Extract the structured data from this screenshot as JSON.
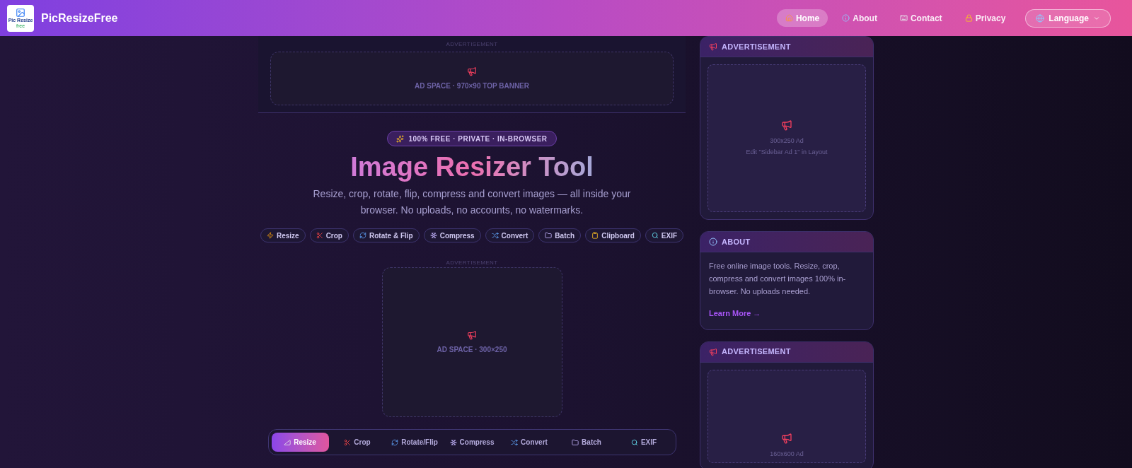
{
  "header": {
    "logo": {
      "line1": "Pic Resize",
      "line2": "free"
    },
    "brand": "PicResizeFree",
    "nav": [
      {
        "label": "Home",
        "selected": true
      },
      {
        "label": "About",
        "selected": false
      },
      {
        "label": "Contact",
        "selected": false
      },
      {
        "label": "Privacy",
        "selected": false
      }
    ],
    "language": "Language"
  },
  "top_ad": {
    "caption": "ADVERTISEMENT",
    "text": "AD SPACE · 970×90 TOP BANNER"
  },
  "hero": {
    "badge": "100% FREE · PRIVATE · IN-BROWSER",
    "title": "Image Resizer Tool",
    "subtitle": "Resize, crop, rotate, flip, compress and convert images — all inside your browser. No uploads, no accounts, no watermarks."
  },
  "chips": [
    "Resize",
    "Crop",
    "Rotate & Flip",
    "Compress",
    "Convert",
    "Batch",
    "Clipboard",
    "EXIF"
  ],
  "mid_ad": {
    "caption": "ADVERTISEMENT",
    "text": "AD SPACE · 300×250"
  },
  "tool_tabs": [
    {
      "label": "Resize",
      "selected": true
    },
    {
      "label": "Crop",
      "selected": false
    },
    {
      "label": "Rotate/Flip",
      "selected": false
    },
    {
      "label": "Compress",
      "selected": false
    },
    {
      "label": "Convert",
      "selected": false
    },
    {
      "label": "Batch",
      "selected": false
    },
    {
      "label": "EXIF",
      "selected": false
    }
  ],
  "sidebar": [
    {
      "kind": "ad",
      "title": "ADVERTISEMENT",
      "lines": [
        "300x250 Ad",
        "Edit \"Sidebar Ad 1\" in Layout"
      ]
    },
    {
      "kind": "about",
      "title": "ABOUT",
      "text": "Free online image tools. Resize, crop, compress and convert images 100% in-browser. No uploads needed.",
      "link": "Learn More →"
    },
    {
      "kind": "ad_tall",
      "title": "ADVERTISEMENT",
      "lines": [
        "160x600 Ad"
      ]
    }
  ]
}
